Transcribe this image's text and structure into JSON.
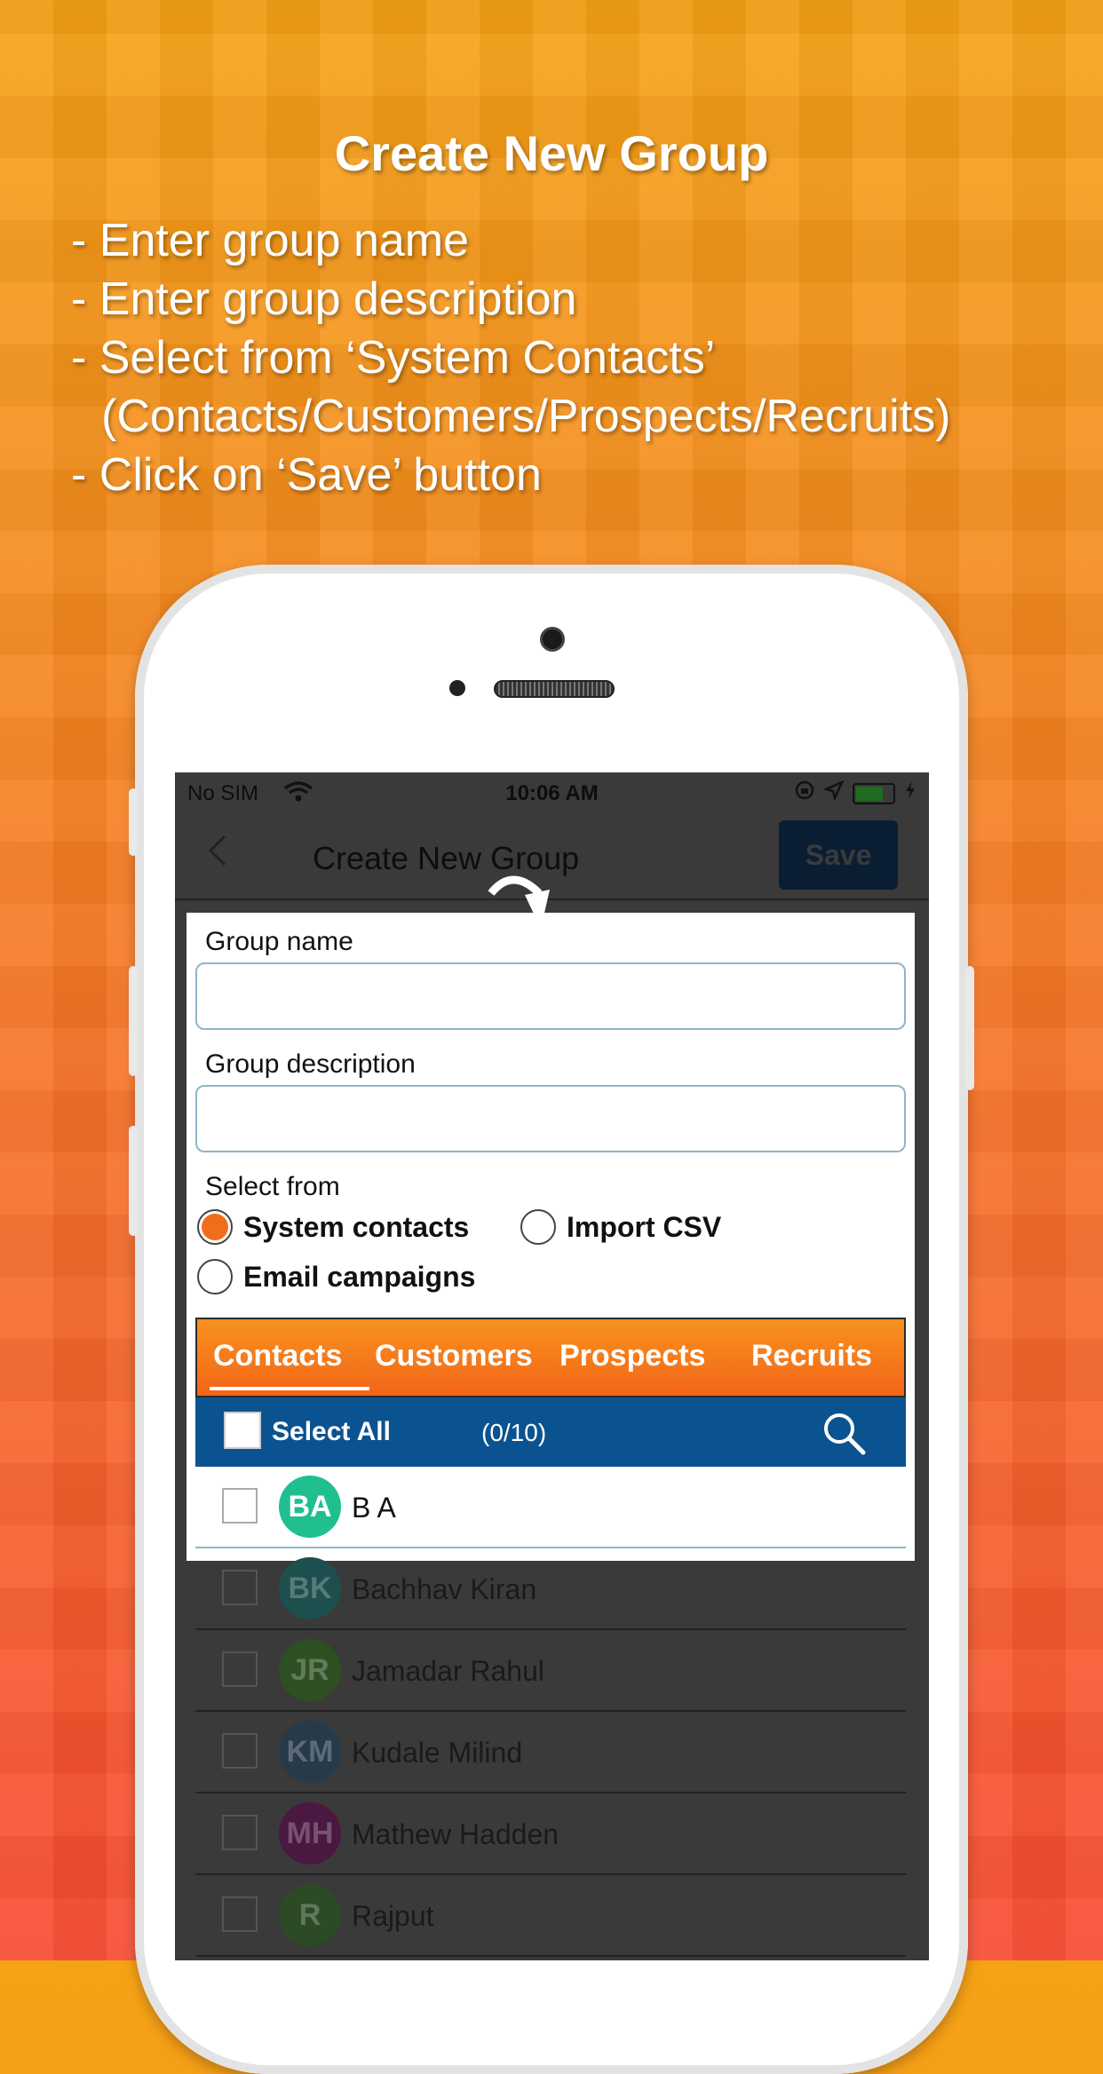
{
  "promo": {
    "title": "Create New Group",
    "lines": [
      "- Enter group name",
      "- Enter group description",
      "- Select from ‘System Contacts’",
      "(Contacts/Customers/Prospects/Recruits)",
      "- Click on ‘Save’ button"
    ]
  },
  "status_bar": {
    "carrier": "No SIM",
    "time": "10:06 AM"
  },
  "nav": {
    "title": "Create New Group",
    "save_label": "Save"
  },
  "form": {
    "group_name_label": "Group name",
    "group_name_value": "",
    "group_description_label": "Group description",
    "group_description_value": "",
    "select_from_label": "Select from",
    "options": [
      {
        "label": "System contacts",
        "selected": true
      },
      {
        "label": "Import CSV",
        "selected": false
      },
      {
        "label": "Email campaigns",
        "selected": false
      }
    ]
  },
  "tabs": [
    {
      "label": "Contacts",
      "active": true
    },
    {
      "label": "Customers",
      "active": false
    },
    {
      "label": "Prospects",
      "active": false
    },
    {
      "label": "Recruits",
      "active": false
    }
  ],
  "select_all": {
    "label": "Select All",
    "count": "(0/10)"
  },
  "contacts": [
    {
      "initials": "BA",
      "name": "B A",
      "color": "#1fbf8f"
    },
    {
      "initials": "BK",
      "name": "Bachhav Kiran",
      "color": "#1c4f4d"
    },
    {
      "initials": "JR",
      "name": "Jamadar Rahul",
      "color": "#2e4f22"
    },
    {
      "initials": "KM",
      "name": "Kudale Milind",
      "color": "#263a4a"
    },
    {
      "initials": "MH",
      "name": "Mathew Hadden",
      "color": "#4a1840"
    },
    {
      "initials": "R",
      "name": "Rajput",
      "color": "#2b4a25"
    }
  ],
  "colors": {
    "accent_orange": "#f26d1b",
    "tab_blue": "#0b5390",
    "save_button_bg": "#0a1e33"
  }
}
